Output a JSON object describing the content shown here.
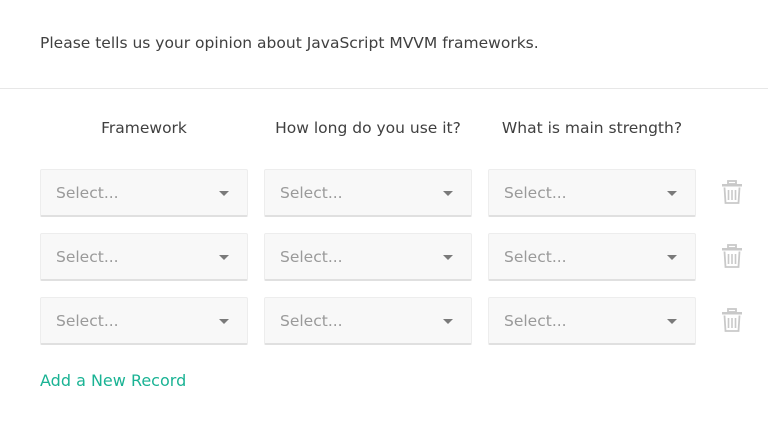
{
  "question": {
    "title": "Please tells us your opinion about JavaScript MVVM frameworks."
  },
  "columns": [
    {
      "label": "Framework"
    },
    {
      "label": "How long do you use it?"
    },
    {
      "label": "What is main strength?"
    }
  ],
  "rows": [
    {
      "cells": [
        {
          "placeholder": "Select..."
        },
        {
          "placeholder": "Select..."
        },
        {
          "placeholder": "Select..."
        }
      ]
    },
    {
      "cells": [
        {
          "placeholder": "Select..."
        },
        {
          "placeholder": "Select..."
        },
        {
          "placeholder": "Select..."
        }
      ]
    },
    {
      "cells": [
        {
          "placeholder": "Select..."
        },
        {
          "placeholder": "Select..."
        },
        {
          "placeholder": "Select..."
        }
      ]
    }
  ],
  "icons": {
    "remove_row": "trash-icon",
    "dropdown": "chevron-down-icon"
  },
  "add_record_label": "Add a New Record",
  "colors": {
    "accent": "#1ab394",
    "text": "#404040",
    "placeholder": "#9a9a9a",
    "field_bg": "#f8f8f8"
  }
}
